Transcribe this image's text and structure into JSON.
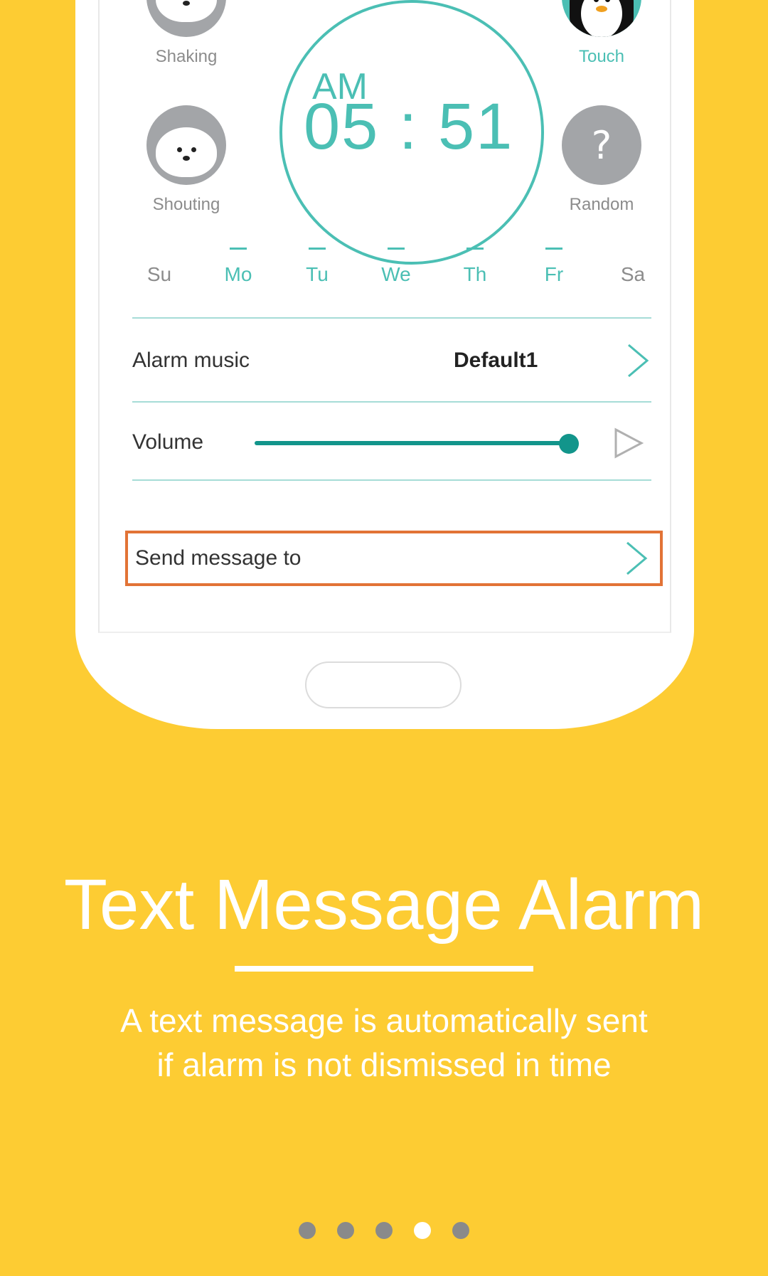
{
  "alarm": {
    "ampm": "AM",
    "time": "05 : 51"
  },
  "modes": {
    "shaking": {
      "label": "Shaking",
      "icon": "polar-bear-icon"
    },
    "shouting": {
      "label": "Shouting",
      "icon": "seal-icon"
    },
    "touch": {
      "label": "Touch",
      "icon": "penguin-icon"
    },
    "random": {
      "label": "Random",
      "icon": "question-mark-icon",
      "glyph": "?"
    }
  },
  "days": [
    {
      "label": "Su",
      "active": false
    },
    {
      "label": "Mo",
      "active": true
    },
    {
      "label": "Tu",
      "active": true
    },
    {
      "label": "We",
      "active": true
    },
    {
      "label": "Th",
      "active": true
    },
    {
      "label": "Fr",
      "active": true
    },
    {
      "label": "Sa",
      "active": false
    }
  ],
  "settings": {
    "alarm_music_label": "Alarm music",
    "alarm_music_value": "Default1",
    "volume_label": "Volume",
    "volume_level": 0.93,
    "send_message_label": "Send message to"
  },
  "headline": "Text Message Alarm",
  "description_line1": "A text message is automatically sent",
  "description_line2": "if alarm is not dismissed in time",
  "page_indicator": {
    "count": 5,
    "active_index": 3
  },
  "colors": {
    "background": "#fdcc33",
    "accent_teal": "#4bbfb4",
    "highlight_orange": "#e27336"
  }
}
